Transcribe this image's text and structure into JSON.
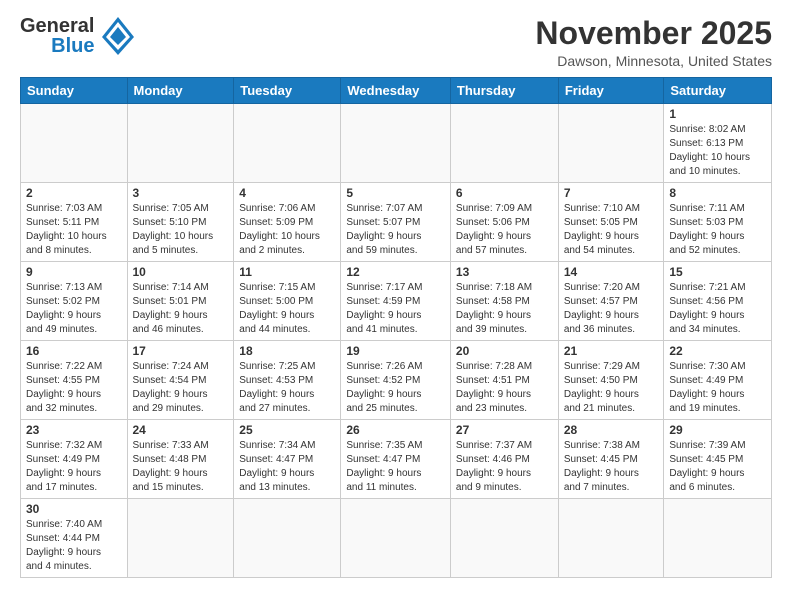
{
  "header": {
    "logo_general": "General",
    "logo_blue": "Blue",
    "month_title": "November 2025",
    "location": "Dawson, Minnesota, United States"
  },
  "weekdays": [
    "Sunday",
    "Monday",
    "Tuesday",
    "Wednesday",
    "Thursday",
    "Friday",
    "Saturday"
  ],
  "weeks": [
    [
      {
        "day": "",
        "info": ""
      },
      {
        "day": "",
        "info": ""
      },
      {
        "day": "",
        "info": ""
      },
      {
        "day": "",
        "info": ""
      },
      {
        "day": "",
        "info": ""
      },
      {
        "day": "",
        "info": ""
      },
      {
        "day": "1",
        "info": "Sunrise: 8:02 AM\nSunset: 6:13 PM\nDaylight: 10 hours\nand 10 minutes."
      }
    ],
    [
      {
        "day": "2",
        "info": "Sunrise: 7:03 AM\nSunset: 5:11 PM\nDaylight: 10 hours\nand 8 minutes."
      },
      {
        "day": "3",
        "info": "Sunrise: 7:05 AM\nSunset: 5:10 PM\nDaylight: 10 hours\nand 5 minutes."
      },
      {
        "day": "4",
        "info": "Sunrise: 7:06 AM\nSunset: 5:09 PM\nDaylight: 10 hours\nand 2 minutes."
      },
      {
        "day": "5",
        "info": "Sunrise: 7:07 AM\nSunset: 5:07 PM\nDaylight: 9 hours\nand 59 minutes."
      },
      {
        "day": "6",
        "info": "Sunrise: 7:09 AM\nSunset: 5:06 PM\nDaylight: 9 hours\nand 57 minutes."
      },
      {
        "day": "7",
        "info": "Sunrise: 7:10 AM\nSunset: 5:05 PM\nDaylight: 9 hours\nand 54 minutes."
      },
      {
        "day": "8",
        "info": "Sunrise: 7:11 AM\nSunset: 5:03 PM\nDaylight: 9 hours\nand 52 minutes."
      }
    ],
    [
      {
        "day": "9",
        "info": "Sunrise: 7:13 AM\nSunset: 5:02 PM\nDaylight: 9 hours\nand 49 minutes."
      },
      {
        "day": "10",
        "info": "Sunrise: 7:14 AM\nSunset: 5:01 PM\nDaylight: 9 hours\nand 46 minutes."
      },
      {
        "day": "11",
        "info": "Sunrise: 7:15 AM\nSunset: 5:00 PM\nDaylight: 9 hours\nand 44 minutes."
      },
      {
        "day": "12",
        "info": "Sunrise: 7:17 AM\nSunset: 4:59 PM\nDaylight: 9 hours\nand 41 minutes."
      },
      {
        "day": "13",
        "info": "Sunrise: 7:18 AM\nSunset: 4:58 PM\nDaylight: 9 hours\nand 39 minutes."
      },
      {
        "day": "14",
        "info": "Sunrise: 7:20 AM\nSunset: 4:57 PM\nDaylight: 9 hours\nand 36 minutes."
      },
      {
        "day": "15",
        "info": "Sunrise: 7:21 AM\nSunset: 4:56 PM\nDaylight: 9 hours\nand 34 minutes."
      }
    ],
    [
      {
        "day": "16",
        "info": "Sunrise: 7:22 AM\nSunset: 4:55 PM\nDaylight: 9 hours\nand 32 minutes."
      },
      {
        "day": "17",
        "info": "Sunrise: 7:24 AM\nSunset: 4:54 PM\nDaylight: 9 hours\nand 29 minutes."
      },
      {
        "day": "18",
        "info": "Sunrise: 7:25 AM\nSunset: 4:53 PM\nDaylight: 9 hours\nand 27 minutes."
      },
      {
        "day": "19",
        "info": "Sunrise: 7:26 AM\nSunset: 4:52 PM\nDaylight: 9 hours\nand 25 minutes."
      },
      {
        "day": "20",
        "info": "Sunrise: 7:28 AM\nSunset: 4:51 PM\nDaylight: 9 hours\nand 23 minutes."
      },
      {
        "day": "21",
        "info": "Sunrise: 7:29 AM\nSunset: 4:50 PM\nDaylight: 9 hours\nand 21 minutes."
      },
      {
        "day": "22",
        "info": "Sunrise: 7:30 AM\nSunset: 4:49 PM\nDaylight: 9 hours\nand 19 minutes."
      }
    ],
    [
      {
        "day": "23",
        "info": "Sunrise: 7:32 AM\nSunset: 4:49 PM\nDaylight: 9 hours\nand 17 minutes."
      },
      {
        "day": "24",
        "info": "Sunrise: 7:33 AM\nSunset: 4:48 PM\nDaylight: 9 hours\nand 15 minutes."
      },
      {
        "day": "25",
        "info": "Sunrise: 7:34 AM\nSunset: 4:47 PM\nDaylight: 9 hours\nand 13 minutes."
      },
      {
        "day": "26",
        "info": "Sunrise: 7:35 AM\nSunset: 4:47 PM\nDaylight: 9 hours\nand 11 minutes."
      },
      {
        "day": "27",
        "info": "Sunrise: 7:37 AM\nSunset: 4:46 PM\nDaylight: 9 hours\nand 9 minutes."
      },
      {
        "day": "28",
        "info": "Sunrise: 7:38 AM\nSunset: 4:45 PM\nDaylight: 9 hours\nand 7 minutes."
      },
      {
        "day": "29",
        "info": "Sunrise: 7:39 AM\nSunset: 4:45 PM\nDaylight: 9 hours\nand 6 minutes."
      }
    ],
    [
      {
        "day": "30",
        "info": "Sunrise: 7:40 AM\nSunset: 4:44 PM\nDaylight: 9 hours\nand 4 minutes."
      },
      {
        "day": "",
        "info": ""
      },
      {
        "day": "",
        "info": ""
      },
      {
        "day": "",
        "info": ""
      },
      {
        "day": "",
        "info": ""
      },
      {
        "day": "",
        "info": ""
      },
      {
        "day": "",
        "info": ""
      }
    ]
  ]
}
